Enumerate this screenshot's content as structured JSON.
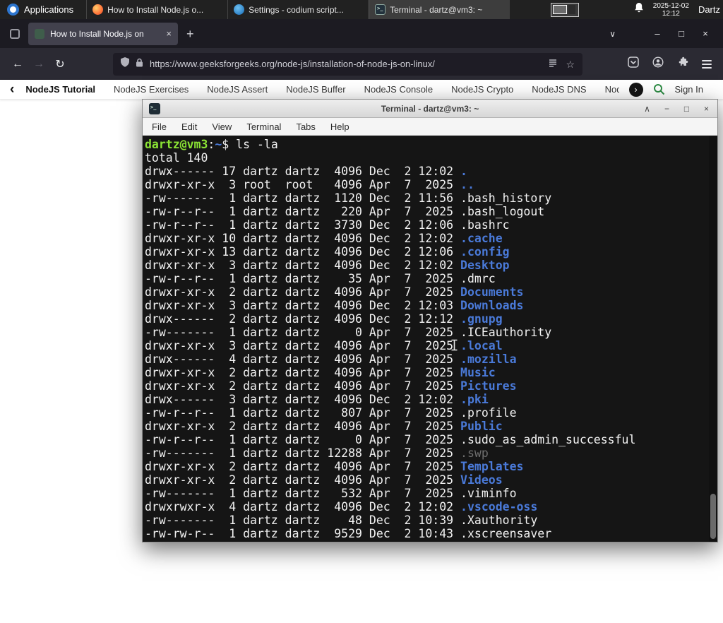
{
  "panel": {
    "applications_label": "Applications",
    "windows": [
      {
        "title": "How to Install Node.js o...",
        "icon": "firefox-icon"
      },
      {
        "title": "Settings - codium script...",
        "icon": "codium-icon"
      },
      {
        "title": "Terminal - dartz@vm3: ~",
        "icon": "terminal-icon"
      }
    ],
    "clock": {
      "date": "2025-12-02",
      "time": "12:12"
    },
    "user_label": "Dartz"
  },
  "browser": {
    "tabbar": {
      "tab_title": "How to Install Node.js on",
      "tab_close_glyph": "×",
      "new_tab_glyph": "+",
      "list_tabs_glyph": "∨",
      "minimize_glyph": "–",
      "maximize_glyph": "□",
      "close_glyph": "×"
    },
    "toolbar": {
      "back_glyph": "←",
      "forward_glyph": "→",
      "reload_glyph": "↻",
      "url": "https://www.geeksforgeeks.org/node-js/installation-of-node-js-on-linux/",
      "bookmark_glyph": "☆"
    },
    "gfg_nav": {
      "back_chevron": "‹",
      "forward_chevron": "›",
      "items": [
        "NodeJS Tutorial",
        "NodeJS Exercises",
        "NodeJS Assert",
        "NodeJS Buffer",
        "NodeJS Console",
        "NodeJS Crypto",
        "NodeJS DNS",
        "Node"
      ],
      "sign_in_label": "Sign In",
      "accent_color": "#2f8d46"
    }
  },
  "terminal": {
    "window_title": "Terminal - dartz@vm3: ~",
    "controls": {
      "shade_glyph": "∧",
      "minimize_glyph": "−",
      "maximize_glyph": "□",
      "close_glyph": "×"
    },
    "menu_items": [
      "File",
      "Edit",
      "View",
      "Terminal",
      "Tabs",
      "Help"
    ],
    "prompt": {
      "user": "dartz@vm3",
      "colon": ":",
      "path": "~",
      "dollar": "$ ",
      "command": "ls -la"
    },
    "total_line": "total 140",
    "colors": {
      "background": "#151515",
      "foreground": "#f2f2f2",
      "prompt_user": "#8ae234",
      "directory": "#4a7ad9",
      "dim": "#6e6e6e"
    },
    "listing": [
      {
        "meta": "drwx------ 17 dartz dartz  4096 Dec  2 12:02 ",
        "name": ".",
        "type": "dir"
      },
      {
        "meta": "drwxr-xr-x  3 root  root   4096 Apr  7  2025 ",
        "name": "..",
        "type": "dir"
      },
      {
        "meta": "-rw-------  1 dartz dartz  1120 Dec  2 11:56 ",
        "name": ".bash_history",
        "type": "file"
      },
      {
        "meta": "-rw-r--r--  1 dartz dartz   220 Apr  7  2025 ",
        "name": ".bash_logout",
        "type": "file"
      },
      {
        "meta": "-rw-r--r--  1 dartz dartz  3730 Dec  2 12:06 ",
        "name": ".bashrc",
        "type": "file"
      },
      {
        "meta": "drwxr-xr-x 10 dartz dartz  4096 Dec  2 12:02 ",
        "name": ".cache",
        "type": "dir"
      },
      {
        "meta": "drwxr-xr-x 13 dartz dartz  4096 Dec  2 12:06 ",
        "name": ".config",
        "type": "dir"
      },
      {
        "meta": "drwxr-xr-x  3 dartz dartz  4096 Dec  2 12:02 ",
        "name": "Desktop",
        "type": "dir"
      },
      {
        "meta": "-rw-r--r--  1 dartz dartz    35 Apr  7  2025 ",
        "name": ".dmrc",
        "type": "file"
      },
      {
        "meta": "drwxr-xr-x  2 dartz dartz  4096 Apr  7  2025 ",
        "name": "Documents",
        "type": "dir"
      },
      {
        "meta": "drwxr-xr-x  3 dartz dartz  4096 Dec  2 12:03 ",
        "name": "Downloads",
        "type": "dir"
      },
      {
        "meta": "drwx------  2 dartz dartz  4096 Dec  2 12:12 ",
        "name": ".gnupg",
        "type": "dir"
      },
      {
        "meta": "-rw-------  1 dartz dartz     0 Apr  7  2025 ",
        "name": ".ICEauthority",
        "type": "file"
      },
      {
        "meta": "drwxr-xr-x  3 dartz dartz  4096 Apr  7  2025 ",
        "name": ".local",
        "type": "dir"
      },
      {
        "meta": "drwx------  4 dartz dartz  4096 Apr  7  2025 ",
        "name": ".mozilla",
        "type": "dir"
      },
      {
        "meta": "drwxr-xr-x  2 dartz dartz  4096 Apr  7  2025 ",
        "name": "Music",
        "type": "dir"
      },
      {
        "meta": "drwxr-xr-x  2 dartz dartz  4096 Apr  7  2025 ",
        "name": "Pictures",
        "type": "dir"
      },
      {
        "meta": "drwx------  3 dartz dartz  4096 Dec  2 12:02 ",
        "name": ".pki",
        "type": "dir"
      },
      {
        "meta": "-rw-r--r--  1 dartz dartz   807 Apr  7  2025 ",
        "name": ".profile",
        "type": "file"
      },
      {
        "meta": "drwxr-xr-x  2 dartz dartz  4096 Apr  7  2025 ",
        "name": "Public",
        "type": "dir"
      },
      {
        "meta": "-rw-r--r--  1 dartz dartz     0 Apr  7  2025 ",
        "name": ".sudo_as_admin_successful",
        "type": "file"
      },
      {
        "meta": "-rw-------  1 dartz dartz 12288 Apr  7  2025 ",
        "name": ".swp",
        "type": "dim"
      },
      {
        "meta": "drwxr-xr-x  2 dartz dartz  4096 Apr  7  2025 ",
        "name": "Templates",
        "type": "dir"
      },
      {
        "meta": "drwxr-xr-x  2 dartz dartz  4096 Apr  7  2025 ",
        "name": "Videos",
        "type": "dir"
      },
      {
        "meta": "-rw-------  1 dartz dartz   532 Apr  7  2025 ",
        "name": ".viminfo",
        "type": "file"
      },
      {
        "meta": "drwxrwxr-x  4 dartz dartz  4096 Dec  2 12:02 ",
        "name": ".vscode-oss",
        "type": "dir"
      },
      {
        "meta": "-rw-------  1 dartz dartz    48 Dec  2 10:39 ",
        "name": ".Xauthority",
        "type": "file"
      },
      {
        "meta": "-rw-rw-r--  1 dartz dartz  9529 Dec  2 10:43 ",
        "name": ".xscreensaver",
        "type": "file"
      }
    ]
  }
}
